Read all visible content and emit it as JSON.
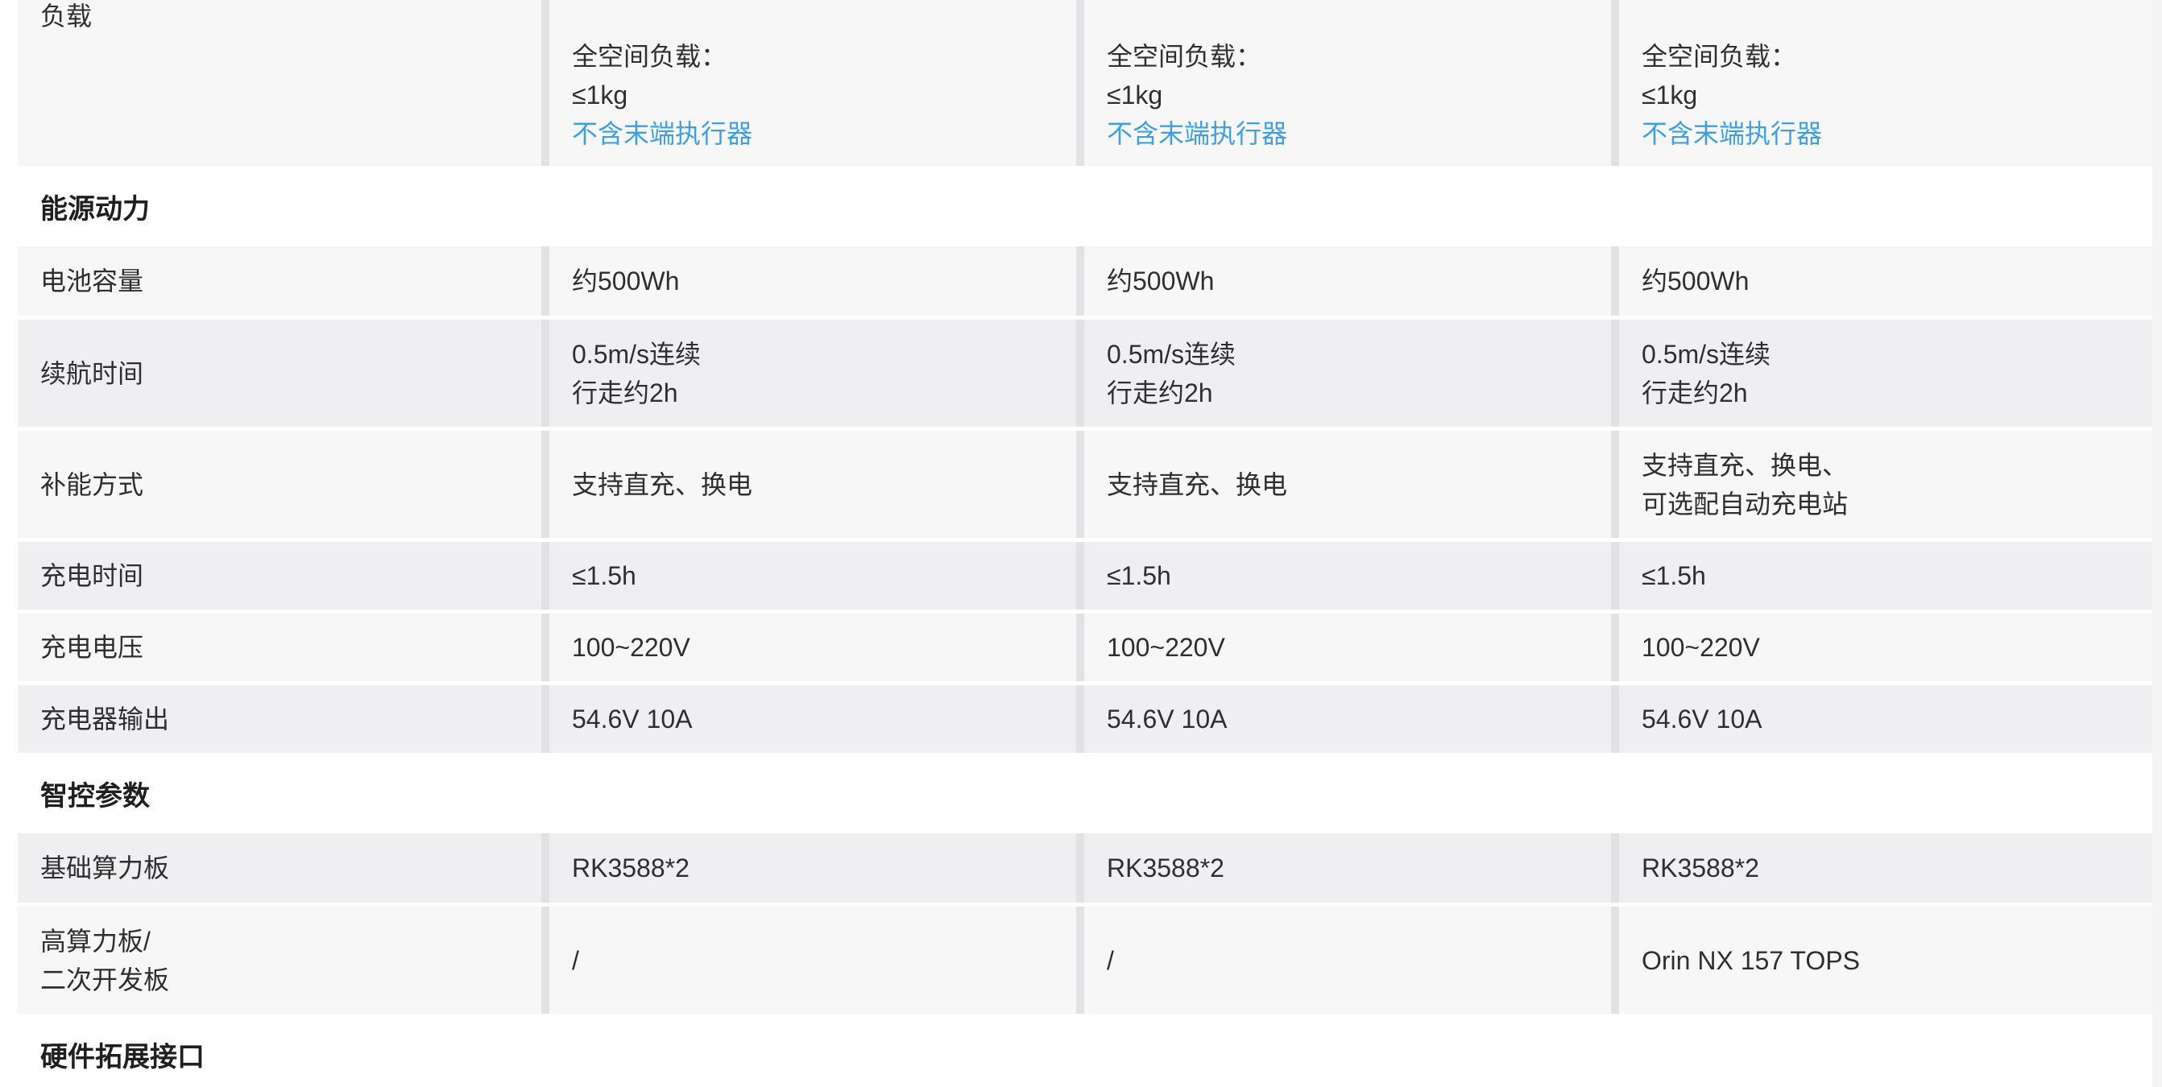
{
  "rows": [
    {
      "type": "param",
      "label": "负载",
      "values": [
        [
          "全空间负载：",
          "≤1kg",
          "不含末端执行器"
        ],
        [
          "全空间负载：",
          "≤1kg",
          "不含末端执行器"
        ],
        [
          "全空间负载：",
          "≤1kg",
          "不含末端执行器"
        ]
      ]
    },
    {
      "type": "section",
      "label": "能源动力"
    },
    {
      "type": "param",
      "label": "电池容量",
      "values": [
        [
          "约500Wh"
        ],
        [
          "约500Wh"
        ],
        [
          "约500Wh"
        ]
      ]
    },
    {
      "type": "param",
      "label": "续航时间",
      "values": [
        [
          "0.5m/s连续",
          "行走约2h"
        ],
        [
          "0.5m/s连续",
          "行走约2h"
        ],
        [
          "0.5m/s连续",
          "行走约2h"
        ]
      ]
    },
    {
      "type": "param",
      "label": "补能方式",
      "values": [
        [
          "支持直充、换电"
        ],
        [
          "支持直充、换电"
        ],
        [
          "支持直充、换电、",
          "可选配自动充电站"
        ]
      ]
    },
    {
      "type": "param",
      "label": "充电时间",
      "values": [
        [
          "≤1.5h"
        ],
        [
          "≤1.5h"
        ],
        [
          "≤1.5h"
        ]
      ]
    },
    {
      "type": "param",
      "label": "充电电压",
      "values": [
        [
          "100~220V"
        ],
        [
          "100~220V"
        ],
        [
          "100~220V"
        ]
      ]
    },
    {
      "type": "param",
      "label": "充电器输出",
      "values": [
        [
          "54.6V 10A"
        ],
        [
          "54.6V 10A"
        ],
        [
          "54.6V 10A"
        ]
      ]
    },
    {
      "type": "section",
      "label": "智控参数"
    },
    {
      "type": "param",
      "label": "基础算力板",
      "values": [
        [
          "RK3588*2"
        ],
        [
          "RK3588*2"
        ],
        [
          "RK3588*2"
        ]
      ]
    },
    {
      "type": "param",
      "label": "高算力板/二次开发板",
      "label_lines": [
        "高算力板/",
        "二次开发板"
      ],
      "values": [
        [
          "/"
        ],
        [
          "/"
        ],
        [
          "Orin NX 157 TOPS"
        ]
      ]
    },
    {
      "type": "section",
      "label": "硬件拓展接口"
    }
  ],
  "colors": {
    "link": "#3ea0e0",
    "row_light": "#f7f7f7",
    "row_dark": "#efeff1",
    "divider": "#e2e2e4"
  }
}
